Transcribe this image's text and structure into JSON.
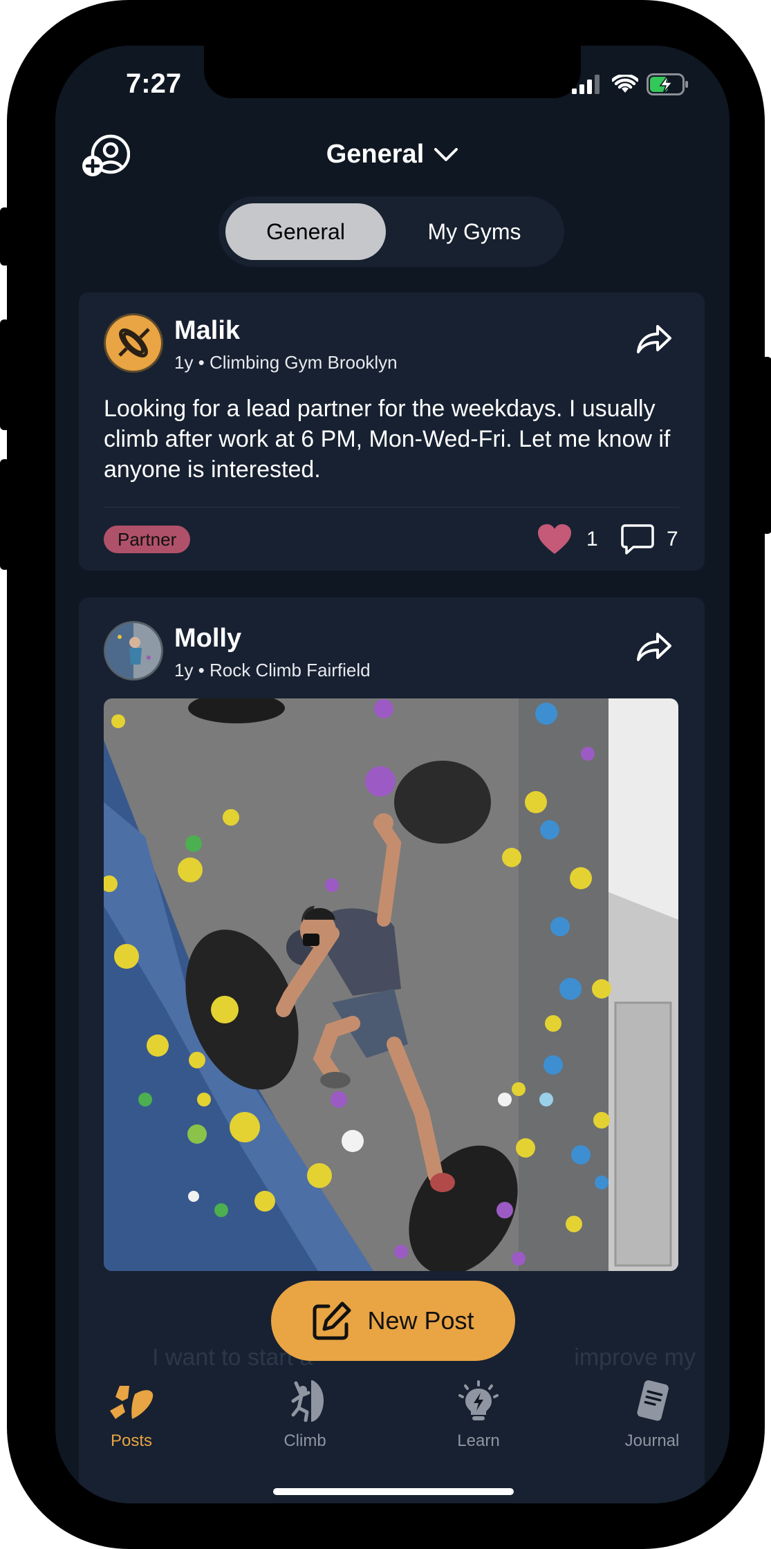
{
  "status_bar": {
    "time": "7:27"
  },
  "header": {
    "title": "General",
    "segments": [
      "General",
      "My Gyms"
    ]
  },
  "posts": [
    {
      "author": "Malik",
      "meta": "1y • Climbing Gym Brooklyn",
      "text": "Looking for a lead partner for the weekdays. I usually climb after work at 6 PM, Mon-Wed-Fri. Let me know if anyone is interested.",
      "tag": "Partner",
      "likes": "1",
      "comments": "7"
    },
    {
      "author": "Molly",
      "meta": "1y • Rock Climb Fairfield",
      "has_photo": true
    }
  ],
  "preview_text": "I want to start a                                        improve my",
  "fab": {
    "label": "New Post"
  },
  "tabs": [
    {
      "label": "Posts",
      "icon": "posts-icon",
      "active": true
    },
    {
      "label": "Climb",
      "icon": "climber-icon"
    },
    {
      "label": "Learn",
      "icon": "lightbulb-icon"
    },
    {
      "label": "Journal",
      "icon": "journal-icon"
    }
  ],
  "colors": {
    "background": "#0f1722",
    "card": "#172131",
    "accent": "#e9a443",
    "tag": "#b0516a",
    "heart": "#c45a78"
  }
}
